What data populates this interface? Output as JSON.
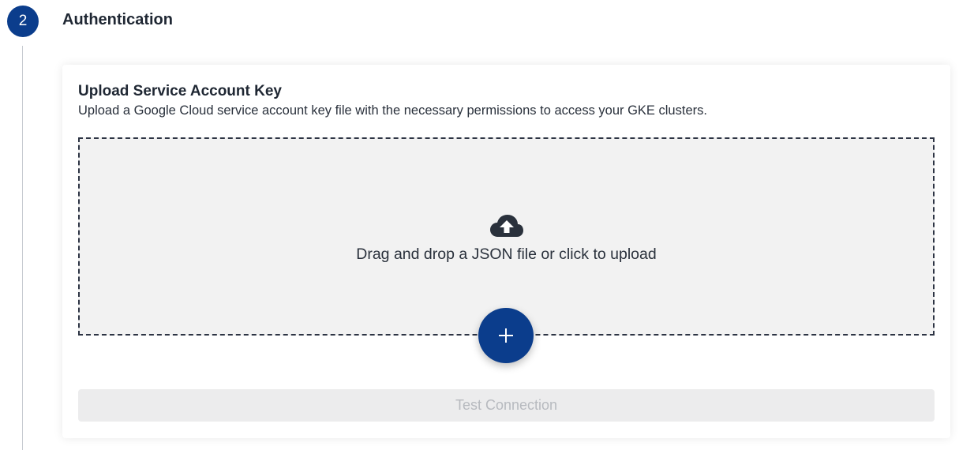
{
  "step": {
    "number": "2",
    "title": "Authentication"
  },
  "upload": {
    "title": "Upload Service Account Key",
    "description": "Upload a Google Cloud service account key file with the necessary permissions to access your GKE clusters.",
    "dropzone_text": "Drag and drop a JSON file or click to upload",
    "dropzone_icon": "cloud-upload-icon",
    "add_icon": "plus-icon"
  },
  "actions": {
    "test_connection_label": "Test Connection",
    "test_connection_disabled": true
  },
  "colors": {
    "accent": "#0b3d8c",
    "dropzone_bg": "#f2f2f2",
    "disabled_bg": "#ececed",
    "disabled_text": "#b7babf"
  }
}
